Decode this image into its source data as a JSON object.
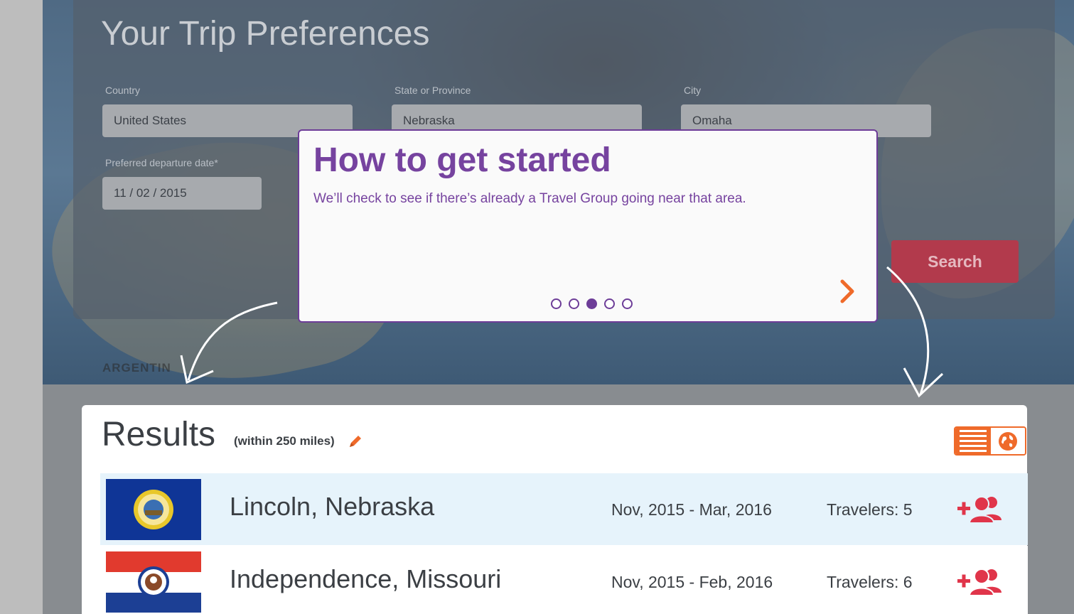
{
  "preferences": {
    "title": "Your Trip Preferences",
    "country": {
      "label": "Country",
      "value": "United States"
    },
    "state": {
      "label": "State or Province",
      "value": "Nebraska"
    },
    "city": {
      "label": "City",
      "value": "Omaha"
    },
    "departure": {
      "label": "Preferred departure date*",
      "value": "11 / 02 / 2015"
    },
    "search_label": "Search",
    "map_text": "ARGENTIN"
  },
  "tooltip": {
    "title": "How to get started",
    "text": "We’ll check to see if there’s already a Travel Group going near that area.",
    "steps_total": 5,
    "active_step": 3
  },
  "results": {
    "title": "Results",
    "radius_note": "(within 250 miles)",
    "rows": [
      {
        "city": "Lincoln, Nebraska",
        "dates": "Nov, 2015 - Mar, 2016",
        "travelers": "Travelers: 5",
        "flag": "nebraska-flag"
      },
      {
        "city": "Independence, Missouri",
        "dates": "Nov, 2015 - Feb, 2016",
        "travelers": "Travelers: 6",
        "flag": "missouri-flag"
      }
    ]
  },
  "colors": {
    "accent_orange": "#ef6a2a",
    "purple": "#76439f",
    "add_red": "#e0354a",
    "search_red": "#b23a4c"
  }
}
